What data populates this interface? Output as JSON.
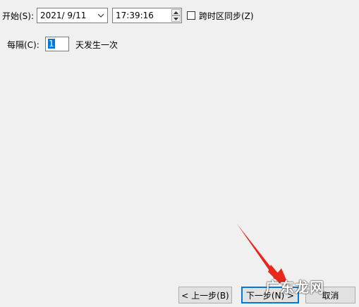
{
  "start": {
    "label": "开始(S):",
    "date_value": "2021/  9/11",
    "time_value": "17:39:16",
    "sync_timezone_label": "跨时区同步(Z)",
    "sync_timezone_checked": false
  },
  "recur": {
    "label": "每隔(C):",
    "value": "1",
    "unit_text": "天发生一次"
  },
  "buttons": {
    "back": "< 上一步(B)",
    "next": "下一步(N) >",
    "cancel": "取消"
  },
  "overlay": {
    "watermark": "广东龙网",
    "arrow_color": "#e8281d"
  }
}
